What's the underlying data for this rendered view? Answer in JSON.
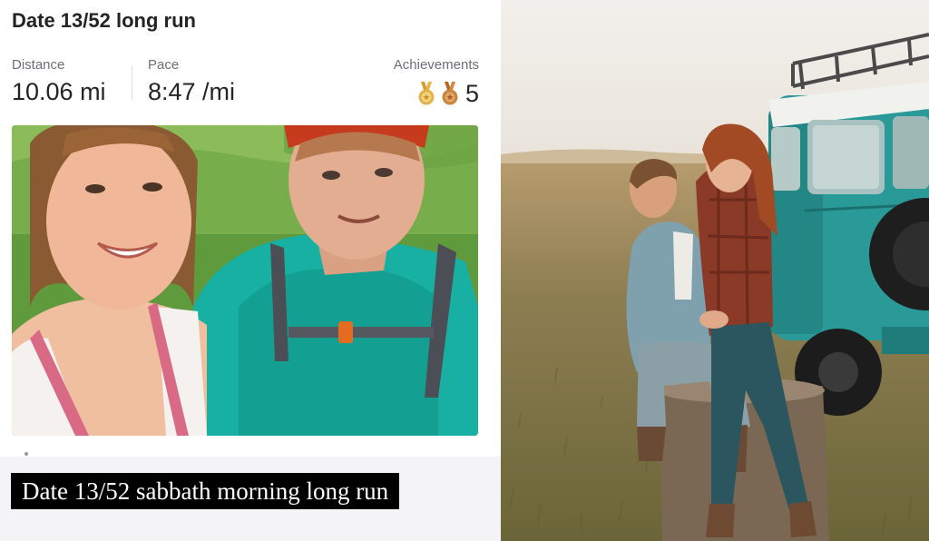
{
  "activity": {
    "title": "Date 13/52 long run",
    "stats": {
      "distance_label": "Distance",
      "distance_value": "10.06 mi",
      "pace_label": "Pace",
      "pace_value": "8:47 /mi",
      "achievements_label": "Achievements",
      "achievements_count": "5"
    },
    "medal_icons": [
      "gold-medal-icon",
      "bronze-medal-icon"
    ],
    "photo": "selfie-couple-running-photo"
  },
  "caption": {
    "text": "Date 13/52 sabbath morning long run"
  },
  "right_photo": "couple-sitting-by-vintage-teal-jeep-photo",
  "colors": {
    "text_primary": "#242428",
    "text_secondary": "#6d6d78",
    "medal_gold": "#e2b24a",
    "medal_bronze": "#c9843c",
    "caption_bg": "#000000",
    "caption_text": "#ffffff",
    "jeep_teal": "#2a9a98"
  }
}
